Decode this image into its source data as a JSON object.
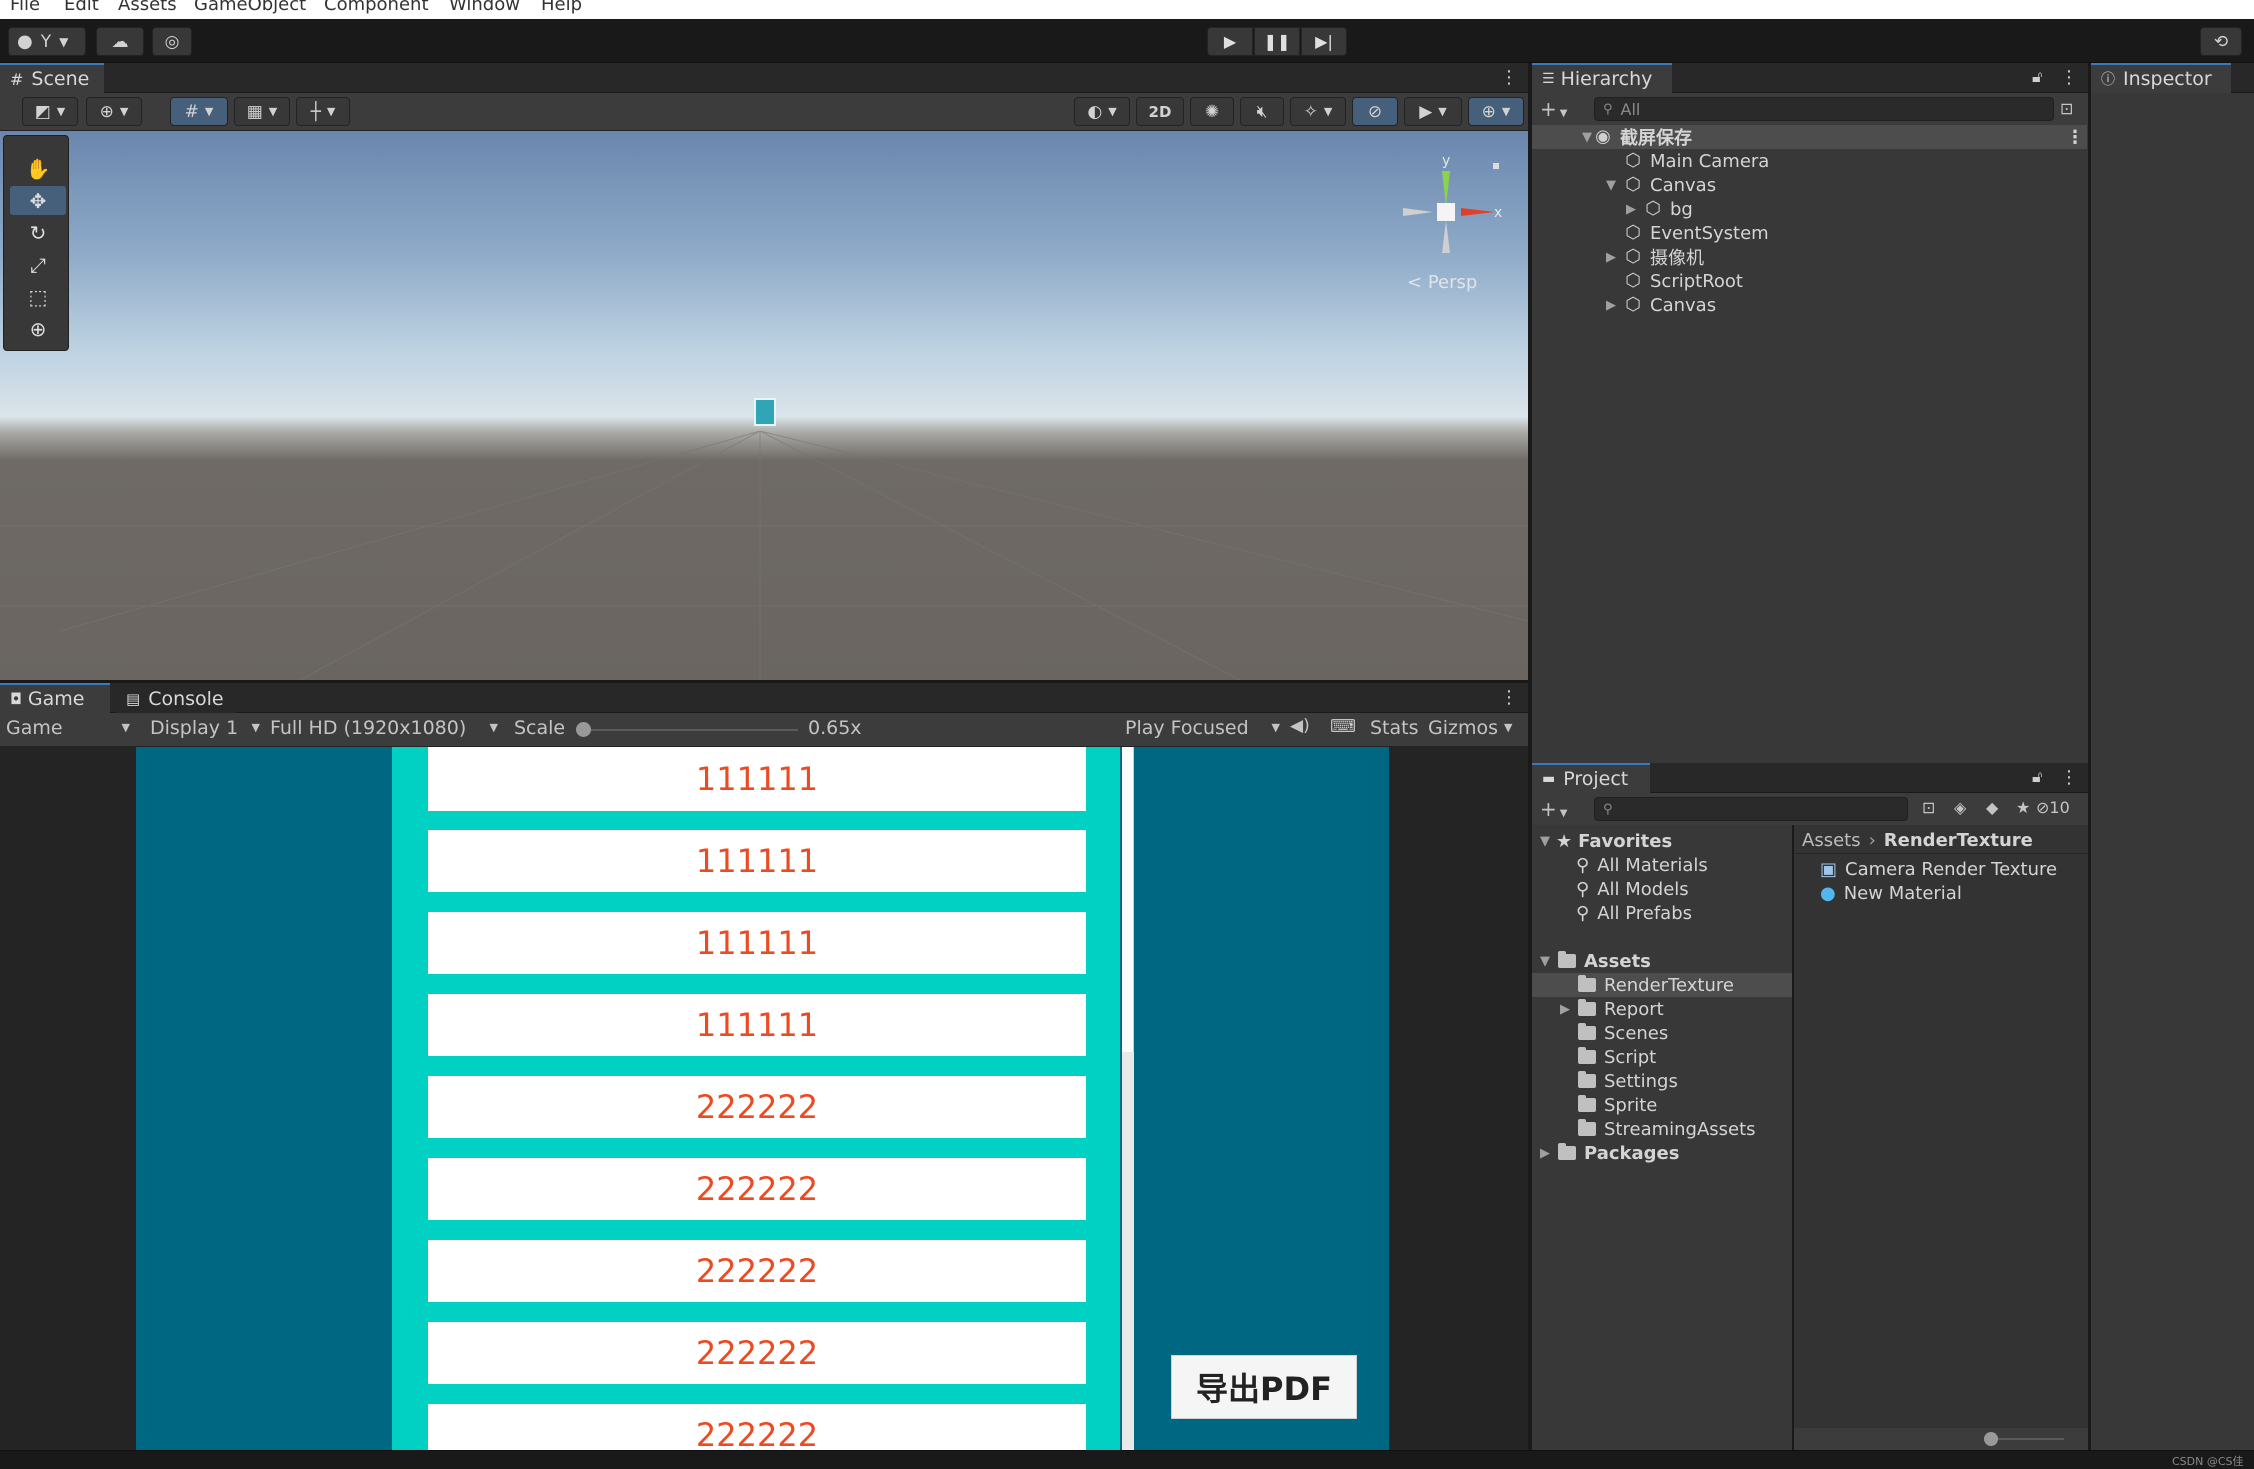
{
  "menu": [
    "File",
    "Edit",
    "Assets",
    "GameObject",
    "Component",
    "Window",
    "Help"
  ],
  "toolbar": {
    "account_label": "Y"
  },
  "scene": {
    "tab_label": "Scene",
    "toggle_2d": "2D",
    "persp_label": "Persp",
    "axis_y": "y",
    "axis_x": "x"
  },
  "game": {
    "tabs": {
      "game": "Game",
      "console": "Console"
    },
    "view_select": "Game",
    "display": "Display 1",
    "resolution": "Full HD (1920x1080)",
    "scale_label": "Scale",
    "scale_value": "0.65x",
    "scale_fraction": 0.0,
    "play_mode": "Play Focused",
    "stats": "Stats",
    "gizmos": "Gizmos",
    "rows": [
      "111111",
      "111111",
      "111111",
      "111111",
      "222222",
      "222222",
      "222222",
      "222222",
      "222222"
    ],
    "export_button": "导出PDF"
  },
  "hierarchy": {
    "tab_label": "Hierarchy",
    "search_placeholder": "All",
    "scene_name": "截屏保存",
    "items": [
      "Main Camera",
      "Canvas",
      "bg",
      "EventSystem",
      "摄像机",
      "ScriptRoot",
      "Canvas"
    ]
  },
  "inspector": {
    "tab_label": "Inspector"
  },
  "project": {
    "tab_label": "Project",
    "hidden_count": "10",
    "favorites_label": "Favorites",
    "favorites": [
      "All Materials",
      "All Models",
      "All Prefabs"
    ],
    "assets_label": "Assets",
    "folders": [
      "RenderTexture",
      "Report",
      "Scenes",
      "Script",
      "Settings",
      "Sprite",
      "StreamingAssets"
    ],
    "packages_label": "Packages",
    "breadcrumb_root": "Assets",
    "breadcrumb_current": "RenderTexture",
    "files": [
      "Camera Render Texture",
      "New Material"
    ]
  },
  "watermark": "CSDN @CS佳"
}
